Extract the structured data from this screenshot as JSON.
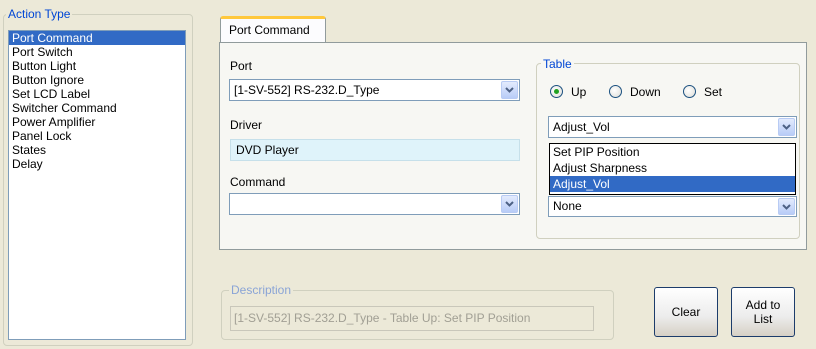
{
  "action_type": {
    "title": "Action Type",
    "items": [
      {
        "label": "Port Command",
        "selected": true
      },
      {
        "label": "Port Switch"
      },
      {
        "label": "Button Light"
      },
      {
        "label": "Button Ignore"
      },
      {
        "label": "Set LCD Label"
      },
      {
        "label": "Switcher Command"
      },
      {
        "label": "Power Amplifier"
      },
      {
        "label": "Panel Lock"
      },
      {
        "label": "States"
      },
      {
        "label": "Delay"
      }
    ]
  },
  "tab": {
    "label": "Port Command"
  },
  "port": {
    "label": "Port",
    "value": "[1-SV-552] RS-232.D_Type"
  },
  "driver": {
    "label": "Driver",
    "value": "DVD Player"
  },
  "command": {
    "label": "Command",
    "value": ""
  },
  "table": {
    "title": "Table",
    "radios": [
      {
        "label": "Up",
        "checked": true
      },
      {
        "label": "Down",
        "checked": false
      },
      {
        "label": "Set",
        "checked": false
      }
    ],
    "combo_value": "Adjust_Vol",
    "dropdown_items": [
      {
        "label": "Set PIP Position"
      },
      {
        "label": "Adjust Sharpness"
      },
      {
        "label": "Adjust_Vol",
        "selected": true
      }
    ],
    "second_combo_value": "None"
  },
  "description": {
    "title": "Description",
    "value": "[1-SV-552] RS-232.D_Type - Table Up: Set PIP Position"
  },
  "buttons": {
    "clear": "Clear",
    "add_line1": "Add to",
    "add_line2": "List"
  },
  "colors": {
    "legend_text": "#0046d5",
    "selection": "#316ac5",
    "tab_highlight": "#ffc83c"
  }
}
